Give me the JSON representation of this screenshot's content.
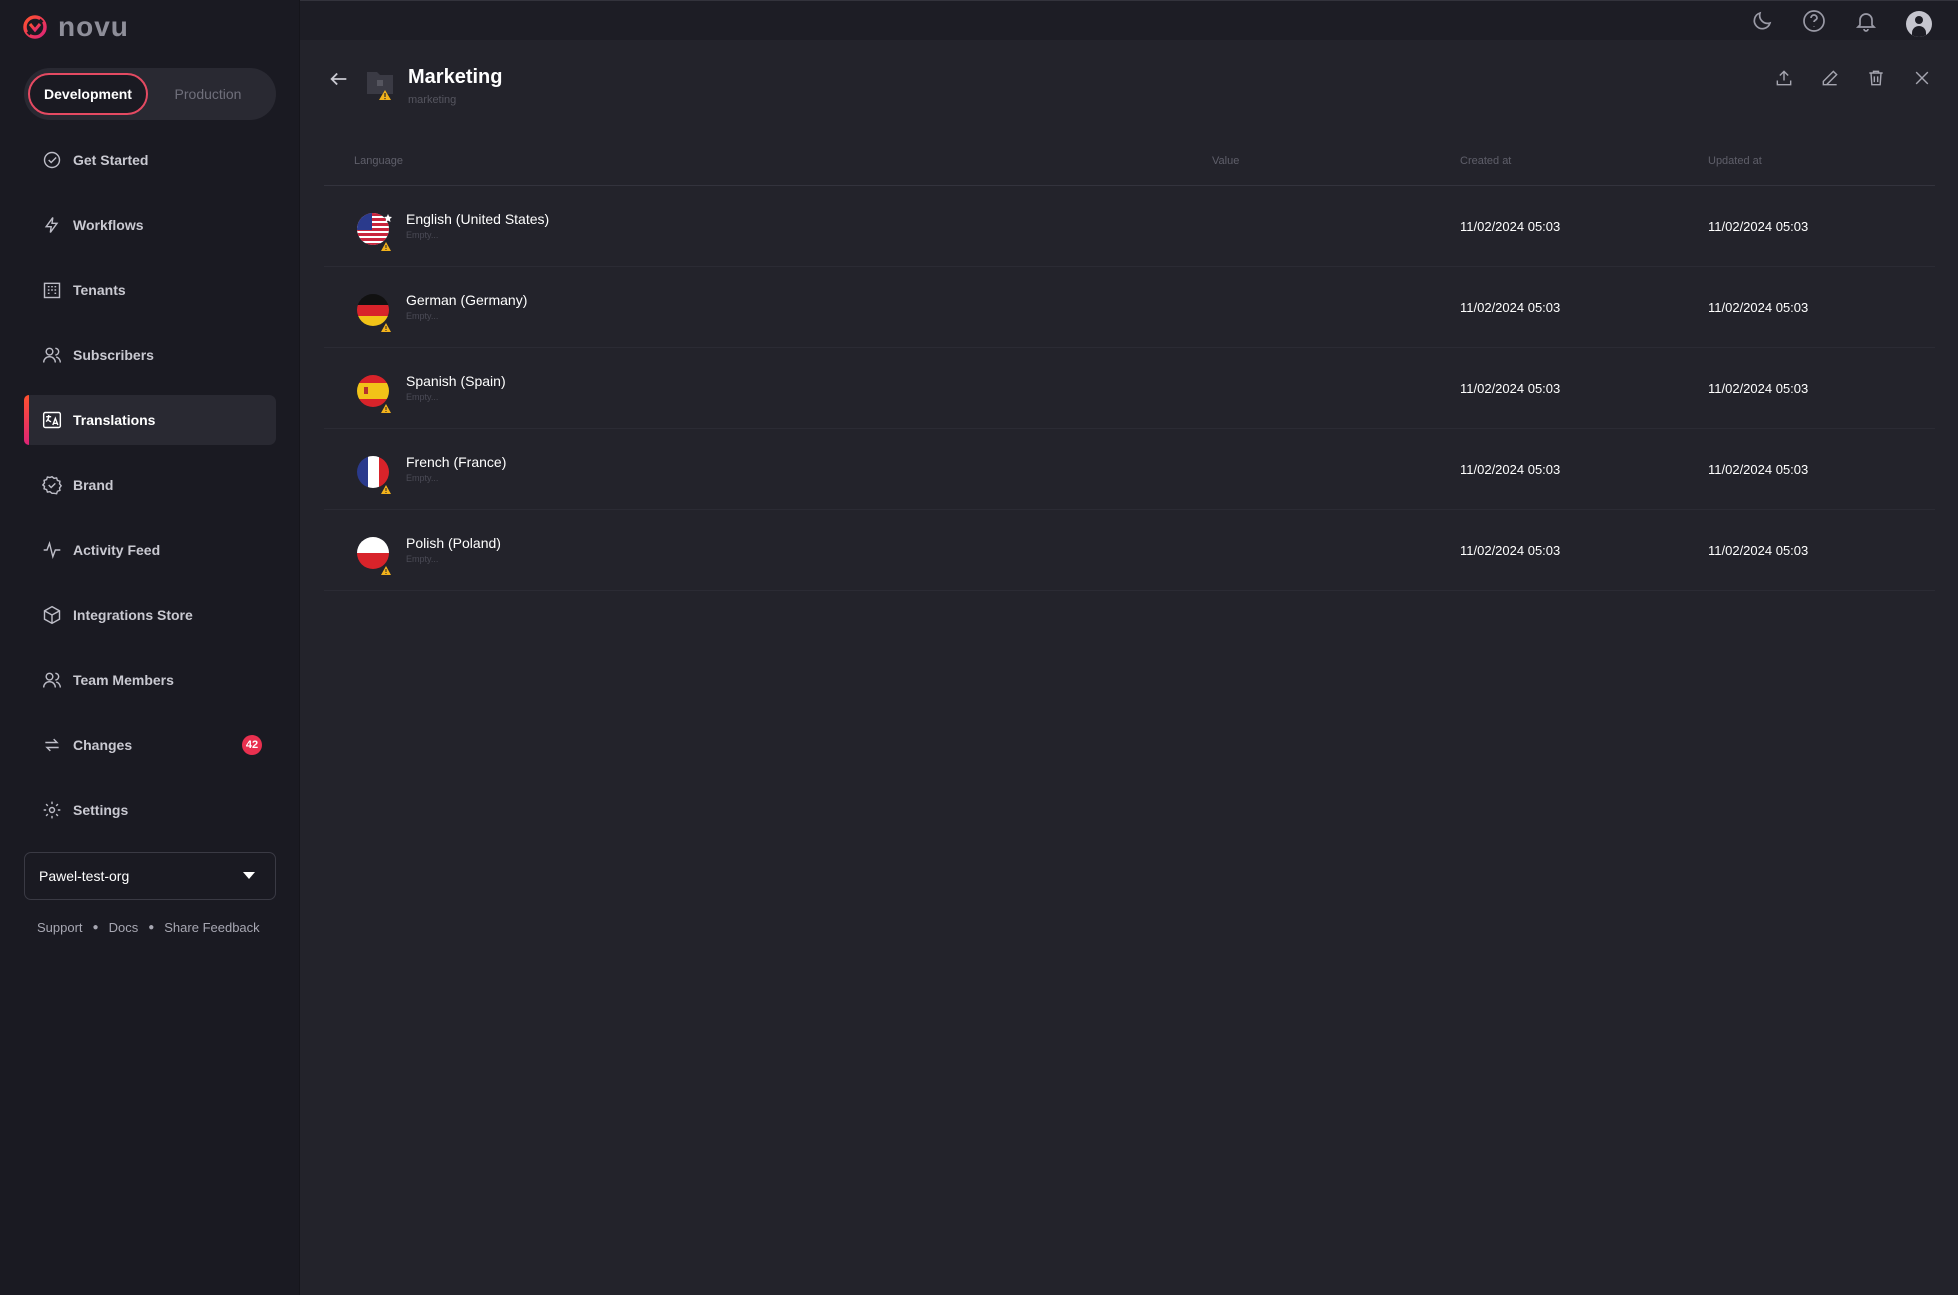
{
  "app": {
    "brand": "novu"
  },
  "environment": {
    "development": "Development",
    "production": "Production",
    "active": "Development"
  },
  "sidebar": {
    "items": [
      {
        "label": "Get Started",
        "icon": "check-circle-icon"
      },
      {
        "label": "Workflows",
        "icon": "bolt-icon"
      },
      {
        "label": "Tenants",
        "icon": "building-icon"
      },
      {
        "label": "Subscribers",
        "icon": "users-icon"
      },
      {
        "label": "Translations",
        "icon": "translate-icon",
        "active": true
      },
      {
        "label": "Brand",
        "icon": "badge-check-icon"
      },
      {
        "label": "Activity Feed",
        "icon": "activity-icon"
      },
      {
        "label": "Integrations Store",
        "icon": "box-icon"
      },
      {
        "label": "Team Members",
        "icon": "team-icon"
      },
      {
        "label": "Changes",
        "icon": "refresh-icon",
        "badge": "42"
      },
      {
        "label": "Settings",
        "icon": "gear-icon"
      }
    ],
    "org": "Pawel-test-org",
    "footer": {
      "support": "Support",
      "docs": "Docs",
      "feedback": "Share Feedback"
    }
  },
  "topbar": {
    "icons": [
      "moon-icon",
      "help-icon",
      "bell-icon",
      "avatar"
    ]
  },
  "group": {
    "title": "Marketing",
    "identifier": "marketing"
  },
  "table": {
    "headers": {
      "language": "Language",
      "value": "Value",
      "created": "Created at",
      "updated": "Updated at"
    },
    "rows": [
      {
        "language": "English (United States)",
        "value": "Empty...",
        "created": "11/02/2024 05:03",
        "updated": "11/02/2024 05:03",
        "flag": "us",
        "default": true
      },
      {
        "language": "German (Germany)",
        "value": "Empty...",
        "created": "11/02/2024 05:03",
        "updated": "11/02/2024 05:03",
        "flag": "de"
      },
      {
        "language": "Spanish (Spain)",
        "value": "Empty...",
        "created": "11/02/2024 05:03",
        "updated": "11/02/2024 05:03",
        "flag": "es"
      },
      {
        "language": "French (France)",
        "value": "Empty...",
        "created": "11/02/2024 05:03",
        "updated": "11/02/2024 05:03",
        "flag": "fr"
      },
      {
        "language": "Polish (Poland)",
        "value": "Empty...",
        "created": "11/02/2024 05:03",
        "updated": "11/02/2024 05:03",
        "flag": "pl"
      }
    ]
  },
  "colors": {
    "accent": "#e54a62",
    "badge": "#e9304f",
    "warning": "#f2b21b"
  }
}
